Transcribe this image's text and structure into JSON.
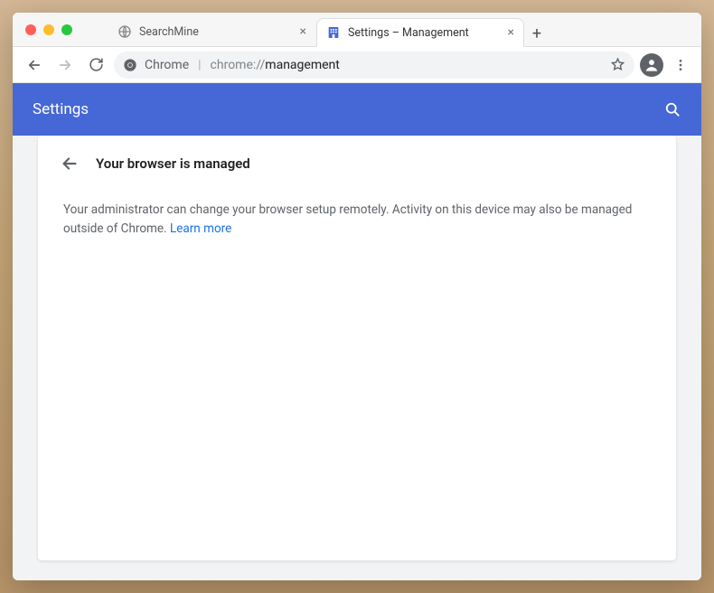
{
  "window": {
    "traffic": {
      "close": "close",
      "min": "minimize",
      "max": "maximize"
    }
  },
  "tabs": [
    {
      "title": "SearchMine",
      "active": false
    },
    {
      "title": "Settings – Management",
      "active": true
    }
  ],
  "toolbar": {
    "chrome_label": "Chrome",
    "url_prefix": "chrome://",
    "url_path": "management"
  },
  "header": {
    "appname": "Settings"
  },
  "page": {
    "title": "Your browser is managed",
    "body": "Your administrator can change your browser setup remotely. Activity on this device may also be managed outside of Chrome.",
    "learn_more": "Learn more"
  }
}
